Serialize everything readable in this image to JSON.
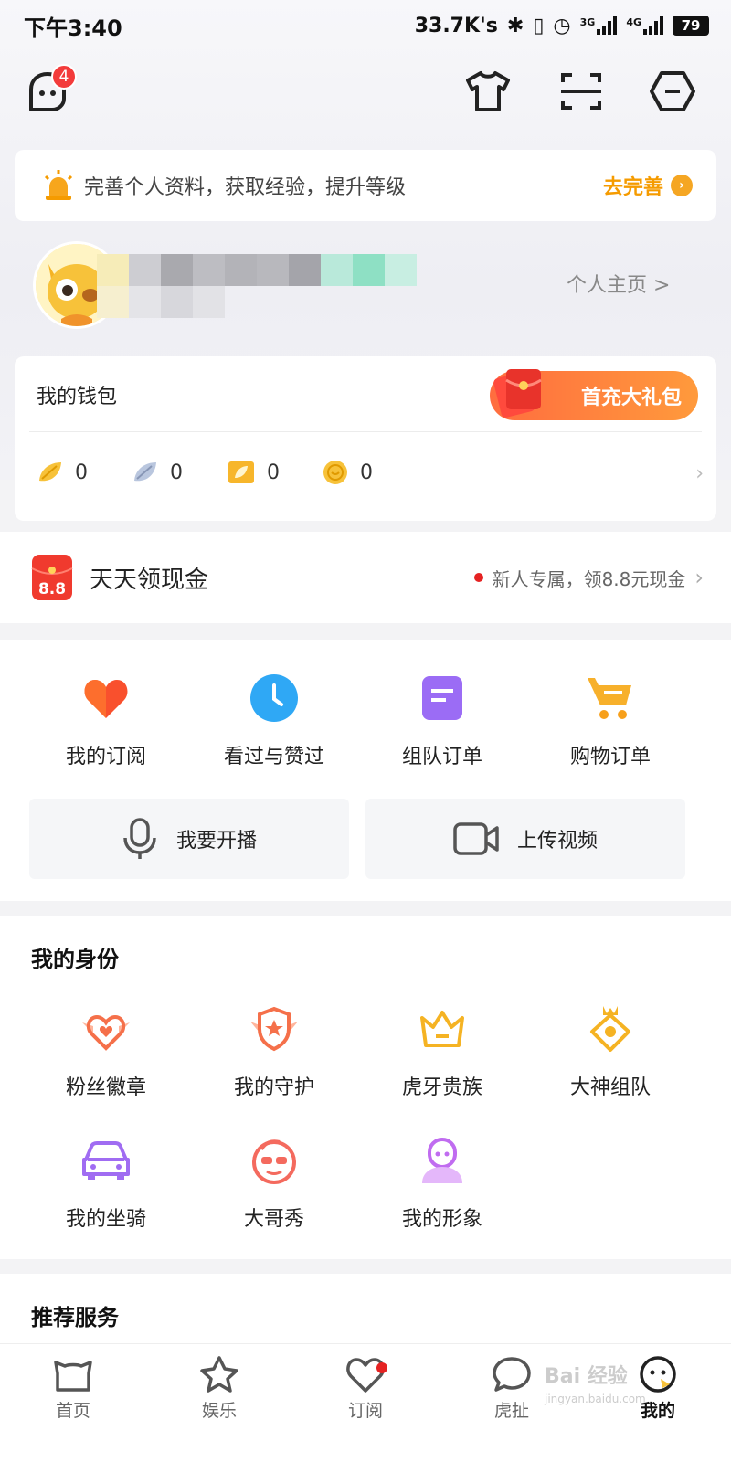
{
  "status_bar": {
    "time": "下午3:40",
    "network_speed": "33.7K's",
    "battery": "79",
    "signal_3g": "3G",
    "signal_4g": "4G"
  },
  "header": {
    "message_badge": "4"
  },
  "profile_prompt": {
    "text": "完善个人资料，获取经验，提升等级",
    "action": "去完善"
  },
  "user": {
    "homepage_link": "个人主页 >"
  },
  "wallet": {
    "title": "我的钱包",
    "gift_button": "首充大礼包",
    "assets": [
      {
        "icon": "gold-bean-icon",
        "value": "0"
      },
      {
        "icon": "silver-bean-icon",
        "value": "0"
      },
      {
        "icon": "ticket-icon",
        "value": "0"
      },
      {
        "icon": "coin-icon",
        "value": "0"
      }
    ]
  },
  "daily_cash": {
    "title": "天天领现金",
    "icon_text": "8.8",
    "promo": "新人专属，领8.8元现金"
  },
  "quick_actions": {
    "items": [
      {
        "label": "我的订阅",
        "icon": "heart-icon"
      },
      {
        "label": "看过与赞过",
        "icon": "clock-icon"
      },
      {
        "label": "组队订单",
        "icon": "document-icon"
      },
      {
        "label": "购物订单",
        "icon": "cart-icon"
      }
    ],
    "start_live": "我要开播",
    "upload_video": "上传视频"
  },
  "identity": {
    "title": "我的身份",
    "items": [
      {
        "label": "粉丝徽章",
        "icon": "fan-badge-icon"
      },
      {
        "label": "我的守护",
        "icon": "guard-shield-icon"
      },
      {
        "label": "虎牙贵族",
        "icon": "crown-icon"
      },
      {
        "label": "大神组队",
        "icon": "god-team-icon"
      },
      {
        "label": "我的坐骑",
        "icon": "car-icon"
      },
      {
        "label": "大哥秀",
        "icon": "big-brother-icon"
      },
      {
        "label": "我的形象",
        "icon": "avatar-figure-icon"
      }
    ]
  },
  "services": {
    "title": "推荐服务"
  },
  "bottom_nav": {
    "items": [
      {
        "label": "首页",
        "icon": "home-icon"
      },
      {
        "label": "娱乐",
        "icon": "star-icon"
      },
      {
        "label": "订阅",
        "icon": "heart-outline-icon"
      },
      {
        "label": "虎扯",
        "icon": "chat-icon"
      },
      {
        "label": "我的",
        "icon": "me-icon"
      }
    ]
  },
  "watermark": {
    "brand": "Bai 经验",
    "url": "jingyan.baidu.com"
  },
  "colors": {
    "accent_orange": "#f59b00",
    "badge_red": "#f33b3b",
    "gift_gradient_start": "#ff6d3f",
    "gift_gradient_end": "#ff9a3c"
  }
}
